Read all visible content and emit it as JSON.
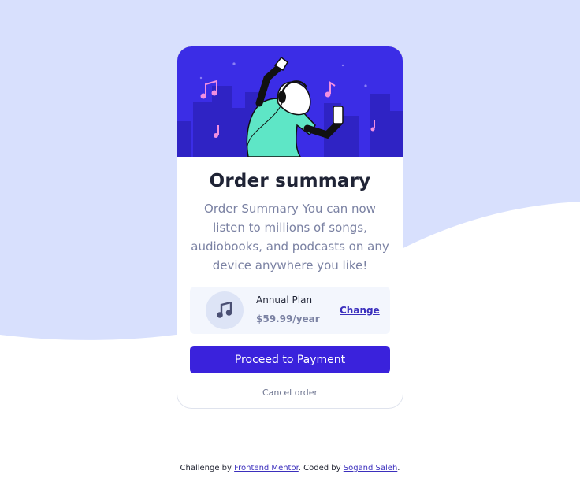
{
  "colors": {
    "background_wave": "#d8e0fd",
    "hero_bg": "#3b2de6",
    "primary": "#3a22dc",
    "title": "#1f2335",
    "muted": "#7b82a3",
    "plan_bg": "#f3f6fd"
  },
  "card": {
    "title": "Order summary",
    "description": "Order Summary You can now listen to millions of songs, audiobooks, and podcasts on any device anywhere you like!",
    "illustration": "hero-illustration-person-dancing-with-headphones",
    "plan": {
      "icon": "music-note-icon",
      "name": "Annual Plan",
      "price": "$59.99/year",
      "change_label": "Change"
    },
    "proceed_label": "Proceed to Payment",
    "cancel_label": "Cancel order"
  },
  "footer": {
    "prefix": "Challenge by ",
    "challenge_link": "Frontend Mentor",
    "middle": ". Coded by ",
    "author_link": "Sogand Saleh",
    "suffix": "."
  }
}
